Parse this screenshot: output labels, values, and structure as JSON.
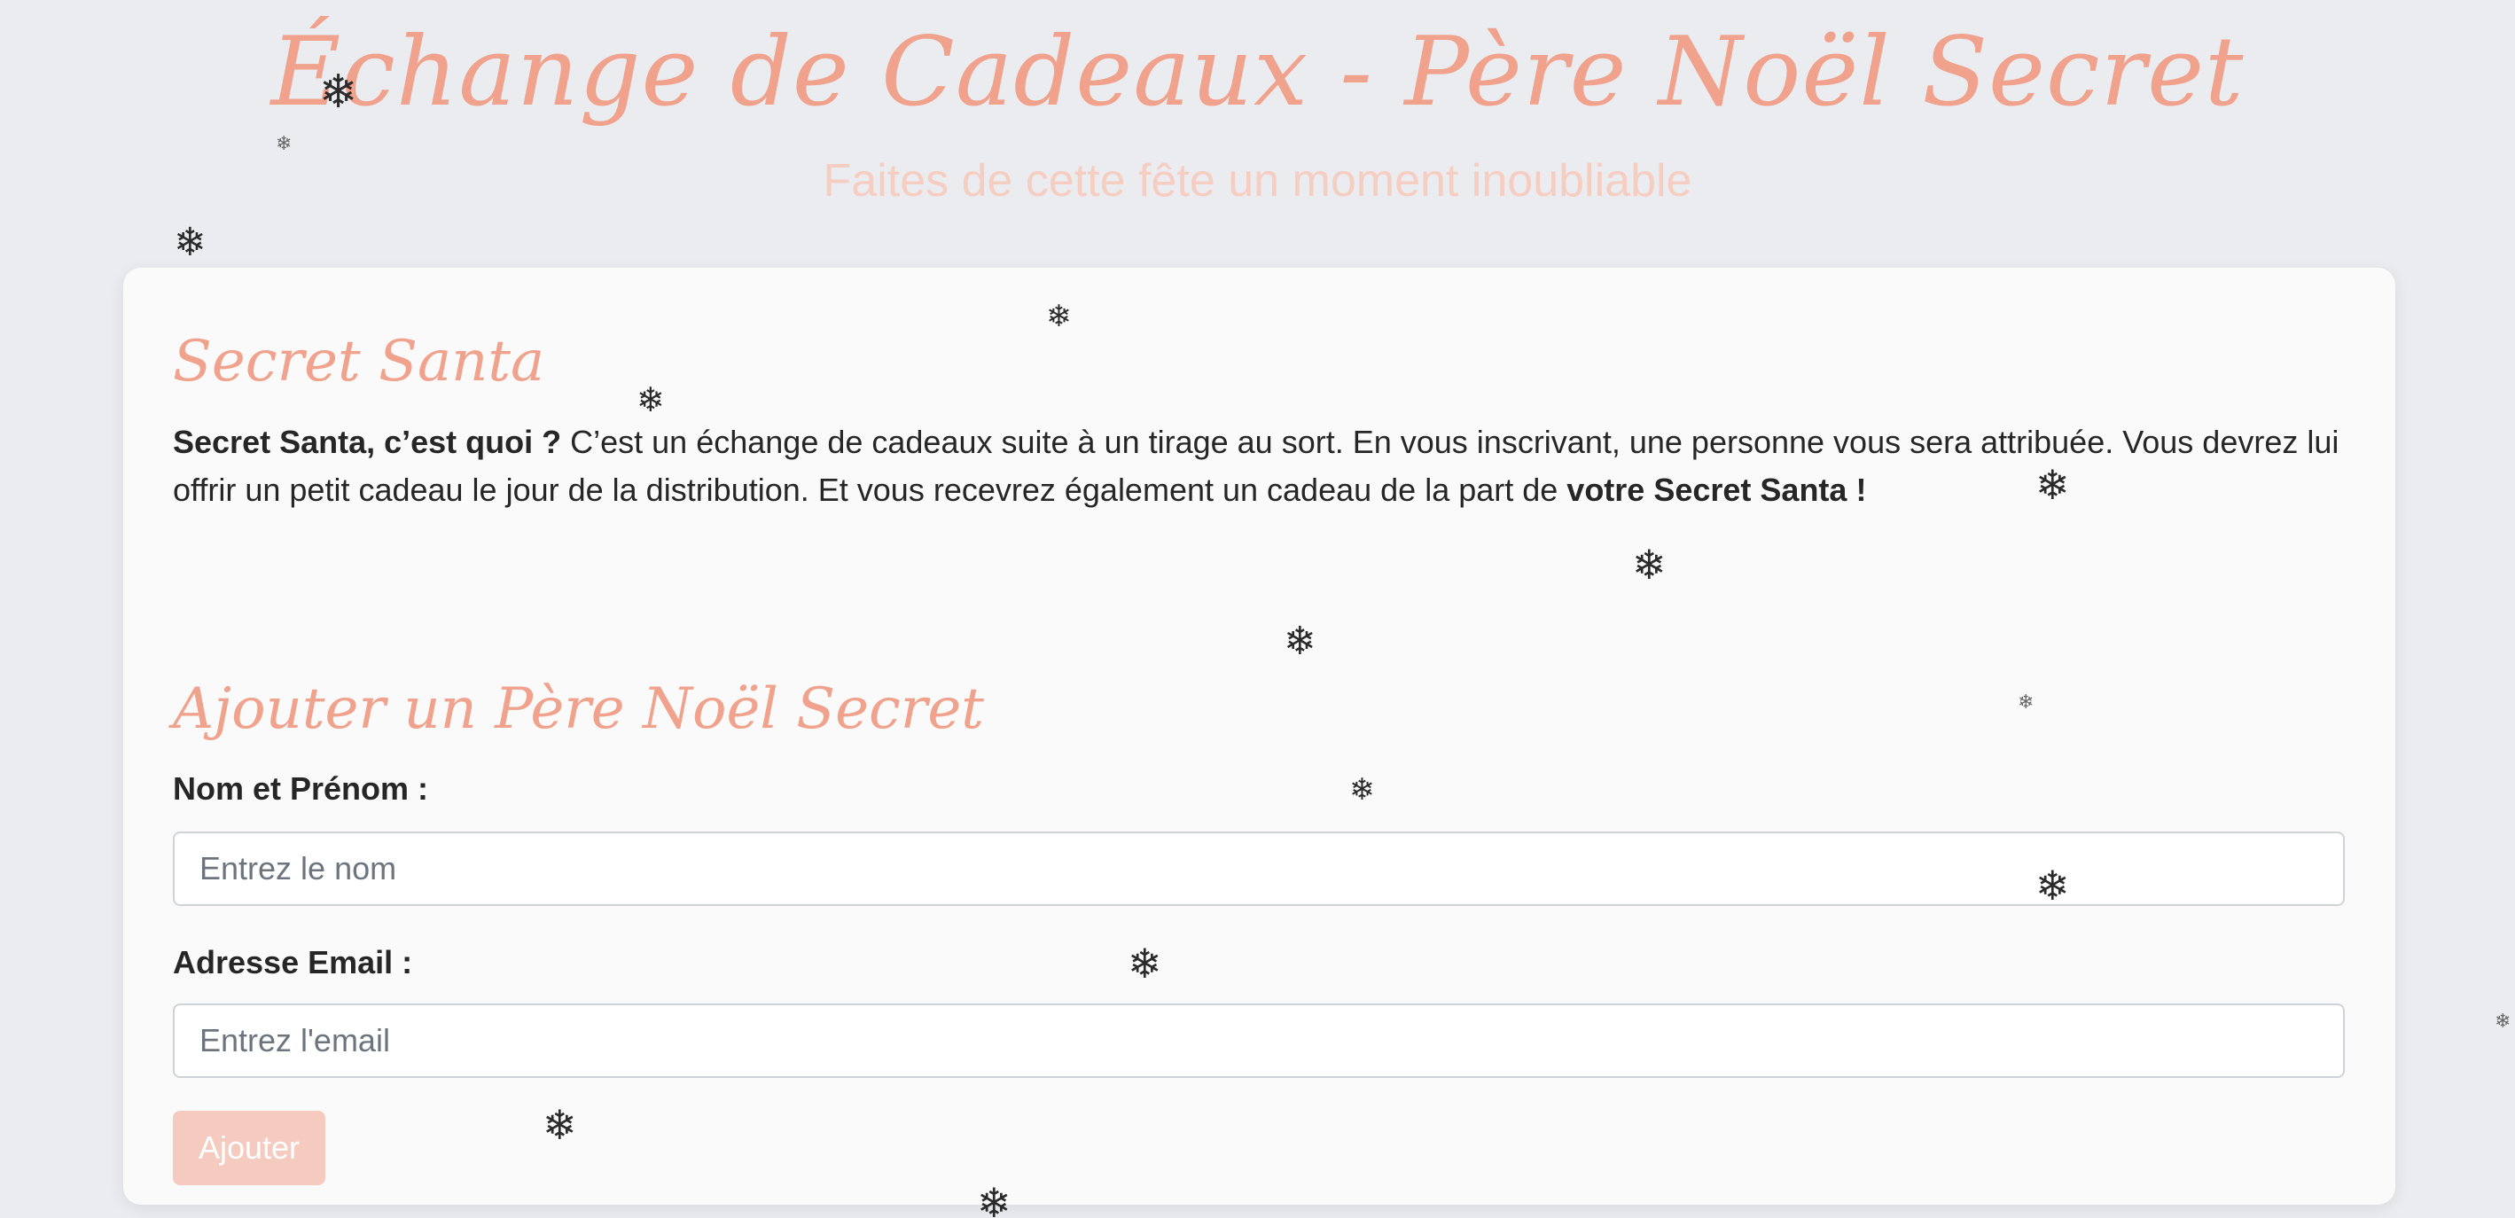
{
  "header": {
    "title": "Échange de Cadeaux - Père Noël Secret",
    "subtitle": "Faites de cette fête un moment inoubliable"
  },
  "intro_section": {
    "title": "Secret Santa",
    "lead_bold": "Secret Santa, c’est quoi ?",
    "body": " C’est un échange de cadeaux suite à un tirage au sort. En vous inscrivant, une personne vous sera attribuée. Vous devrez lui offrir un petit cadeau le jour de la distribution. Et vous recevrez également un cadeau de la part de ",
    "tail_bold": "votre Secret Santa !"
  },
  "form": {
    "title": "Ajouter un Père Noël Secret",
    "name_label": "Nom et Prénom :",
    "name_placeholder": "Entrez le nom",
    "name_value": "",
    "email_label": "Adresse Email :",
    "email_placeholder": "Entrez l'email",
    "email_value": "",
    "submit_label": "Ajouter"
  },
  "decor": {
    "snowflake_icon": "snowflake-icon",
    "snowflake_glyph": "❄"
  },
  "theme": {
    "accent": "#f0a28c",
    "accent_light": "#f6cdc1",
    "button_bg": "#f5cbc0",
    "background": "#ebecf0",
    "card": "#fafafa"
  }
}
